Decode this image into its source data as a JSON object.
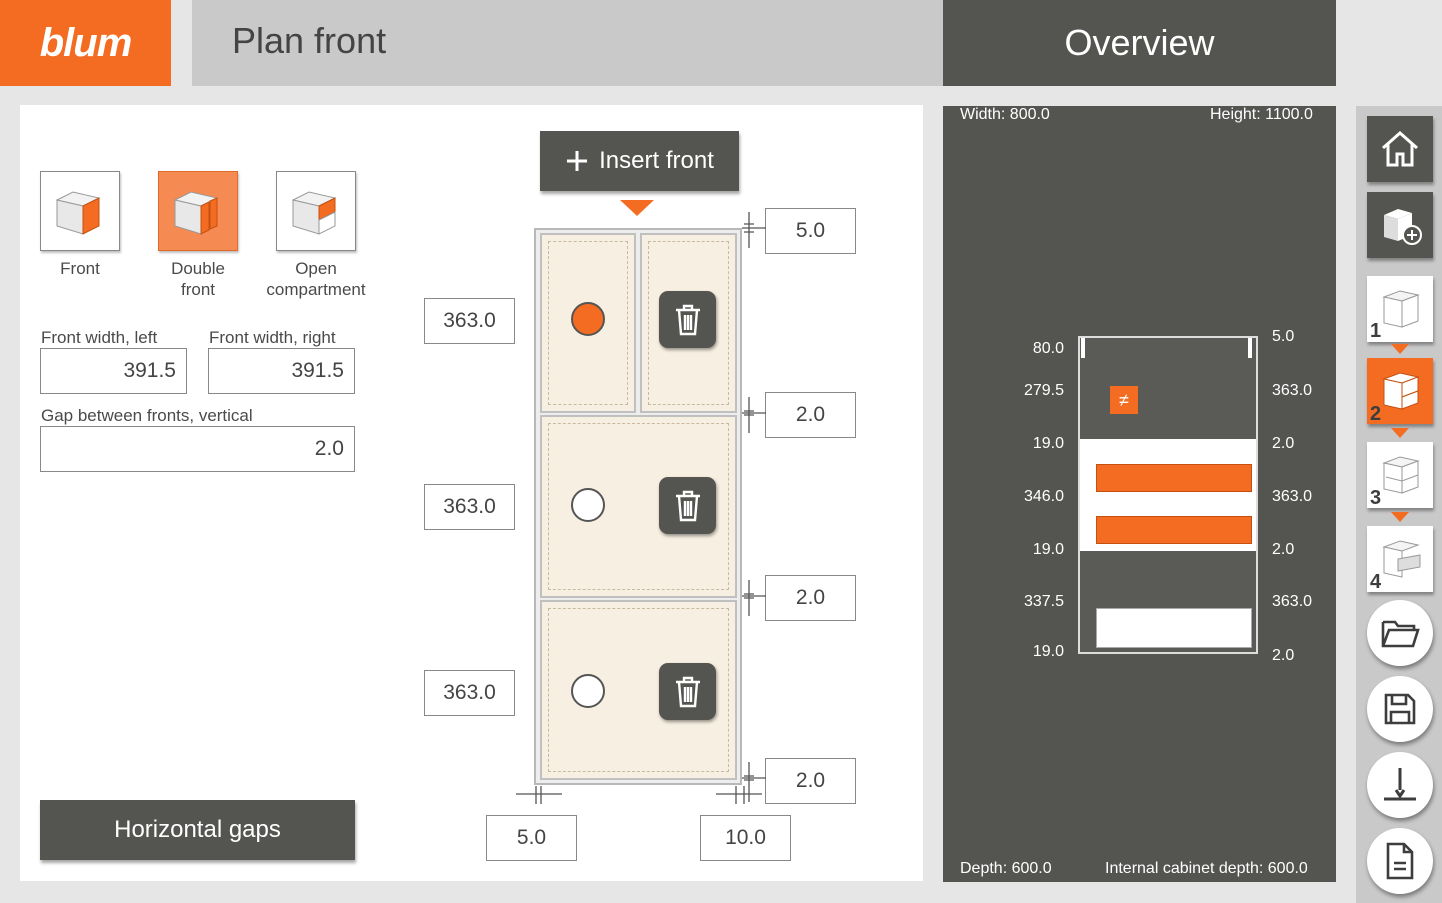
{
  "brand": {
    "logo": "blum"
  },
  "header": {
    "title": "Plan front",
    "overview": "Overview"
  },
  "front_types": [
    {
      "label": "Front",
      "selected": false
    },
    {
      "label": "Double\nfront",
      "selected": true
    },
    {
      "label": "Open\ncompartment",
      "selected": false
    }
  ],
  "fields": {
    "front_width_left_label": "Front width, left",
    "front_width_left": "391.5",
    "front_width_right_label": "Front width, right",
    "front_width_right": "391.5",
    "gap_vertical_label": "Gap between fronts, vertical",
    "gap_vertical": "2.0"
  },
  "buttons": {
    "horizontal_gaps": "Horizontal gaps",
    "insert_front": "Insert front"
  },
  "plan": {
    "heights": [
      "363.0",
      "363.0",
      "363.0"
    ],
    "gaps": [
      "5.0",
      "2.0",
      "2.0",
      "2.0"
    ],
    "bottom_left": "5.0",
    "bottom_right": "10.0"
  },
  "overview": {
    "width": "Width: 800.0",
    "height": "Height: 1100.0",
    "depth": "Depth: 600.0",
    "internal_depth": "Internal cabinet depth: 600.0",
    "left_values": [
      "80.0",
      "279.5",
      "19.0",
      "346.0",
      "19.0",
      "337.5",
      "19.0"
    ],
    "right_values": [
      "5.0",
      "363.0",
      "2.0",
      "363.0",
      "2.0",
      "363.0",
      "2.0"
    ]
  },
  "sidebar": {
    "steps": [
      "1",
      "2",
      "3",
      "4"
    ]
  },
  "colors": {
    "accent": "#f36c21",
    "dark": "#545451",
    "light": "#c9c9c9"
  },
  "icons": [
    "home-icon",
    "cabinet-add-icon",
    "folder-open-icon",
    "save-icon",
    "measure-icon",
    "document-icon",
    "trash-icon",
    "plus-icon"
  ]
}
